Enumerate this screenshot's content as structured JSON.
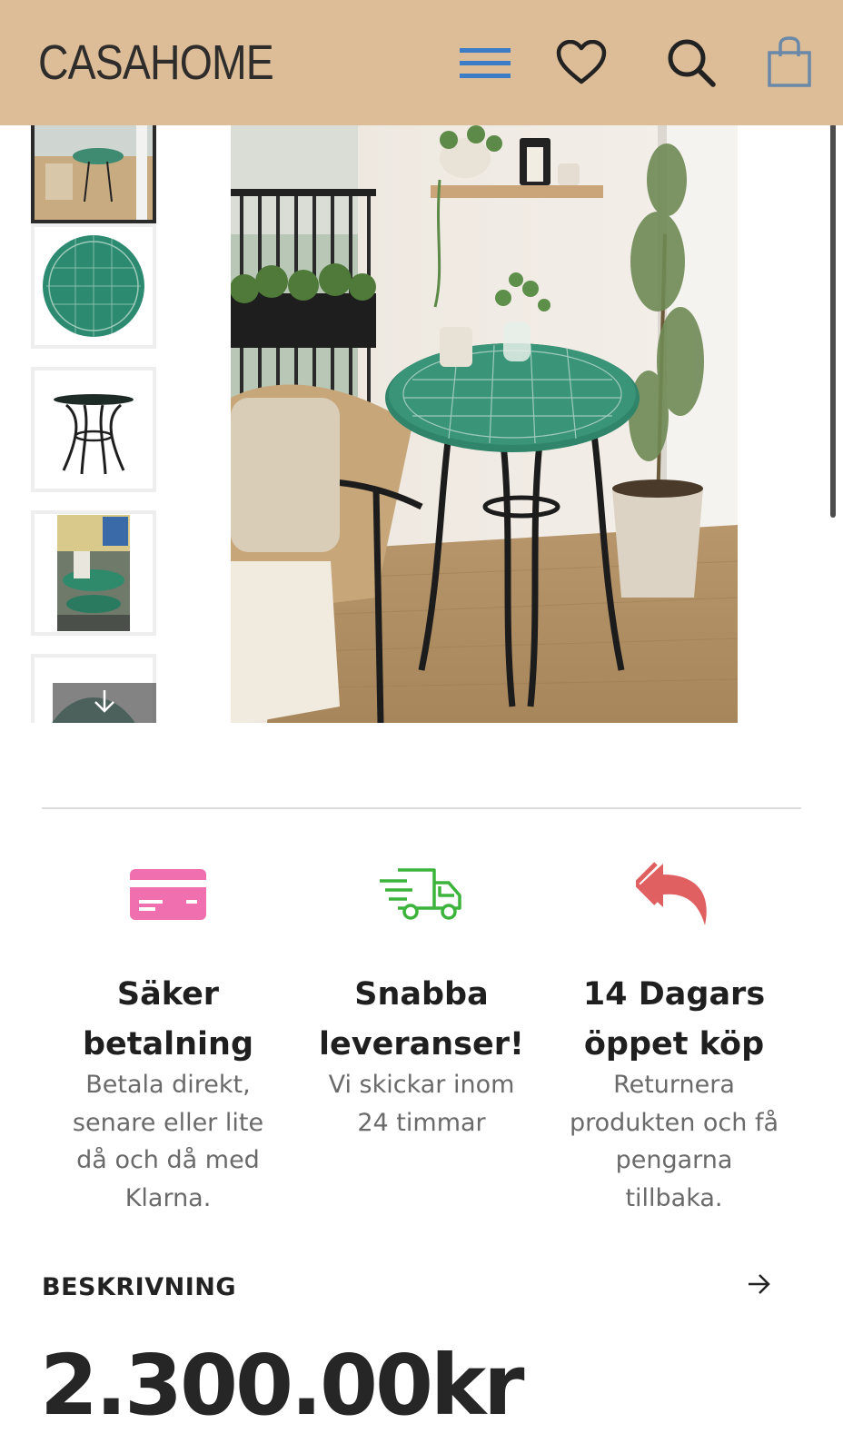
{
  "header": {
    "brand": "CASAHOME",
    "icons": [
      "menu-icon",
      "heart-icon",
      "search-icon",
      "bag-icon"
    ]
  },
  "gallery": {
    "thumbnails": [
      {
        "label": "balcony bistro set photo",
        "active": true
      },
      {
        "label": "mosaic tabletop green"
      },
      {
        "label": "black metal table frame"
      },
      {
        "label": "store display photo"
      },
      {
        "label": "mosaic tabletop partial"
      }
    ],
    "scroll_down_icon": "arrow-down-icon"
  },
  "features": [
    {
      "icon": "credit-card-icon",
      "color": "#f06fae",
      "title_line1": "Säker",
      "title_line2": "betalning",
      "desc": [
        "Betala direkt,",
        "senare eller lite",
        "då och då med",
        "Klarna."
      ]
    },
    {
      "icon": "delivery-truck-icon",
      "color": "#3cb43c",
      "title_line1": "Snabba",
      "title_line2": "leveranser!",
      "desc": [
        "Vi skickar inom",
        "24 timmar"
      ]
    },
    {
      "icon": "return-arrow-icon",
      "color": "#e06062",
      "title_line1": "14 Dagars",
      "title_line2": "öppet köp",
      "desc": [
        "Returnera",
        "produkten och få",
        "pengarna",
        "tillbaka."
      ]
    }
  ],
  "description": {
    "label": "BESKRIVNING",
    "icon": "arrow-right-icon"
  },
  "price": "2.300.00kr",
  "colors": {
    "header_bg": "#dcbd97",
    "menu_accent": "#3a7dc4"
  }
}
